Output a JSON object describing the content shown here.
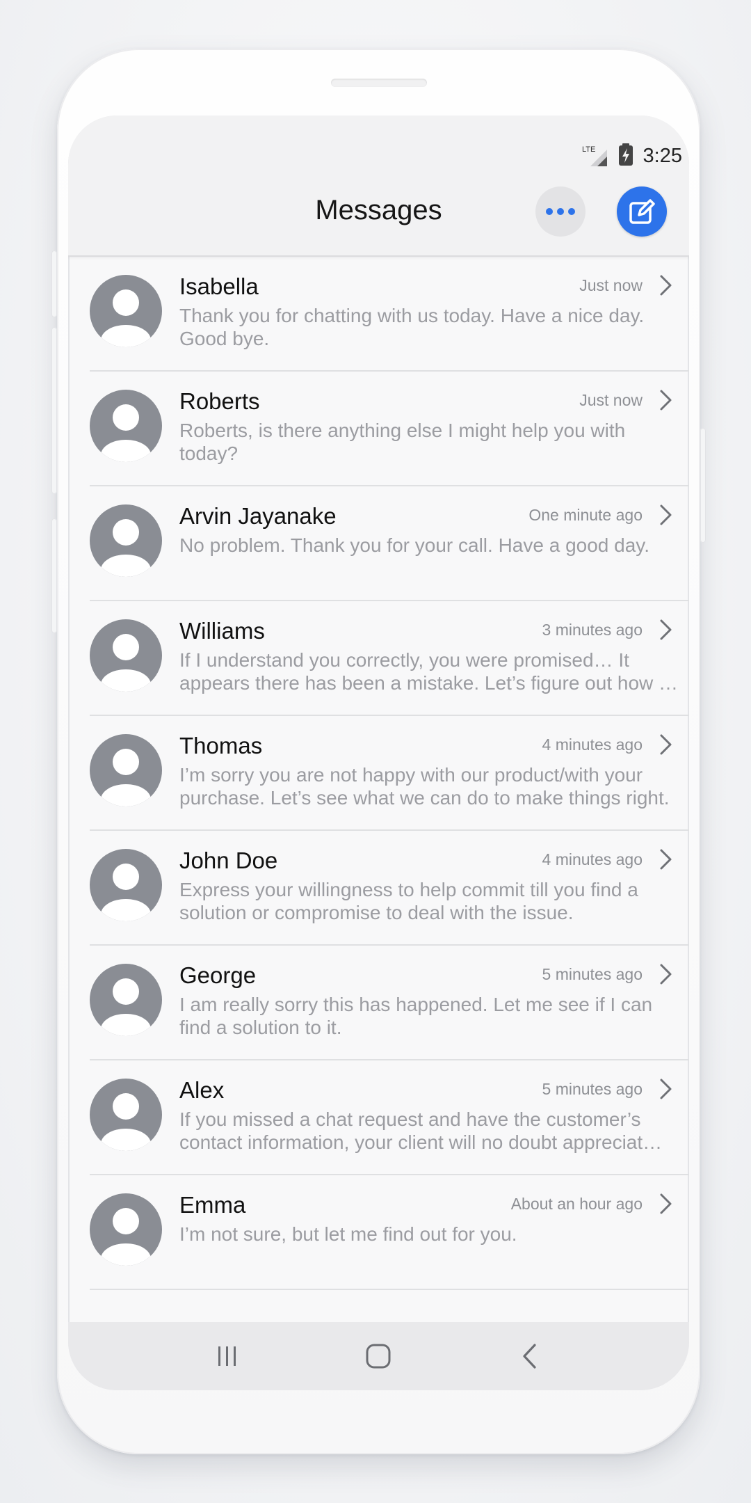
{
  "status_bar": {
    "network": "LTE",
    "time": "3:25"
  },
  "header": {
    "title": "Messages",
    "more_icon": "more-horizontal-icon",
    "compose_icon": "compose-icon"
  },
  "colors": {
    "accent": "#2d73ea",
    "avatar": "#8a8d94"
  },
  "conversations": [
    {
      "name": "Isabella",
      "time": "Just now",
      "line1": "Thank you for chatting with us today. Have a nice day.",
      "line2": "Good bye."
    },
    {
      "name": "Roberts",
      "time": "Just now",
      "line1": "Roberts, is there anything else I might help you with",
      "line2": "today?"
    },
    {
      "name": "Arvin Jayanake",
      "time": "One minute ago",
      "line1": "No problem. Thank you for your call. Have a good day.",
      "line2": ""
    },
    {
      "name": "Williams",
      "time": "3 minutes ago",
      "line1": "If I understand you correctly, you were promised… It",
      "line2": "appears there has been a mistake. Let’s figure out how …"
    },
    {
      "name": "Thomas",
      "time": "4 minutes ago",
      "line1": "I’m sorry you are not happy with our product/with your",
      "line2": "purchase. Let’s see what we can do to make things right."
    },
    {
      "name": "John Doe",
      "time": "4 minutes ago",
      "line1": "Express your willingness to help commit till you find a",
      "line2": "solution or compromise to deal with the issue."
    },
    {
      "name": "George",
      "time": "5 minutes ago",
      "line1": "I am really sorry this has happened. Let me see if I can",
      "line2": "find a solution to it."
    },
    {
      "name": "Alex",
      "time": "5 minutes ago",
      "line1": "If you missed a chat request and have the customer’s",
      "line2": "contact information, your client will no doubt appreciat…"
    },
    {
      "name": "Emma",
      "time": "About an hour ago",
      "line1": "I’m not sure, but let me find out for you.",
      "line2": ""
    }
  ],
  "nav_bar": {
    "recents_icon": "recents-icon",
    "home_icon": "home-icon",
    "back_icon": "back-icon"
  }
}
